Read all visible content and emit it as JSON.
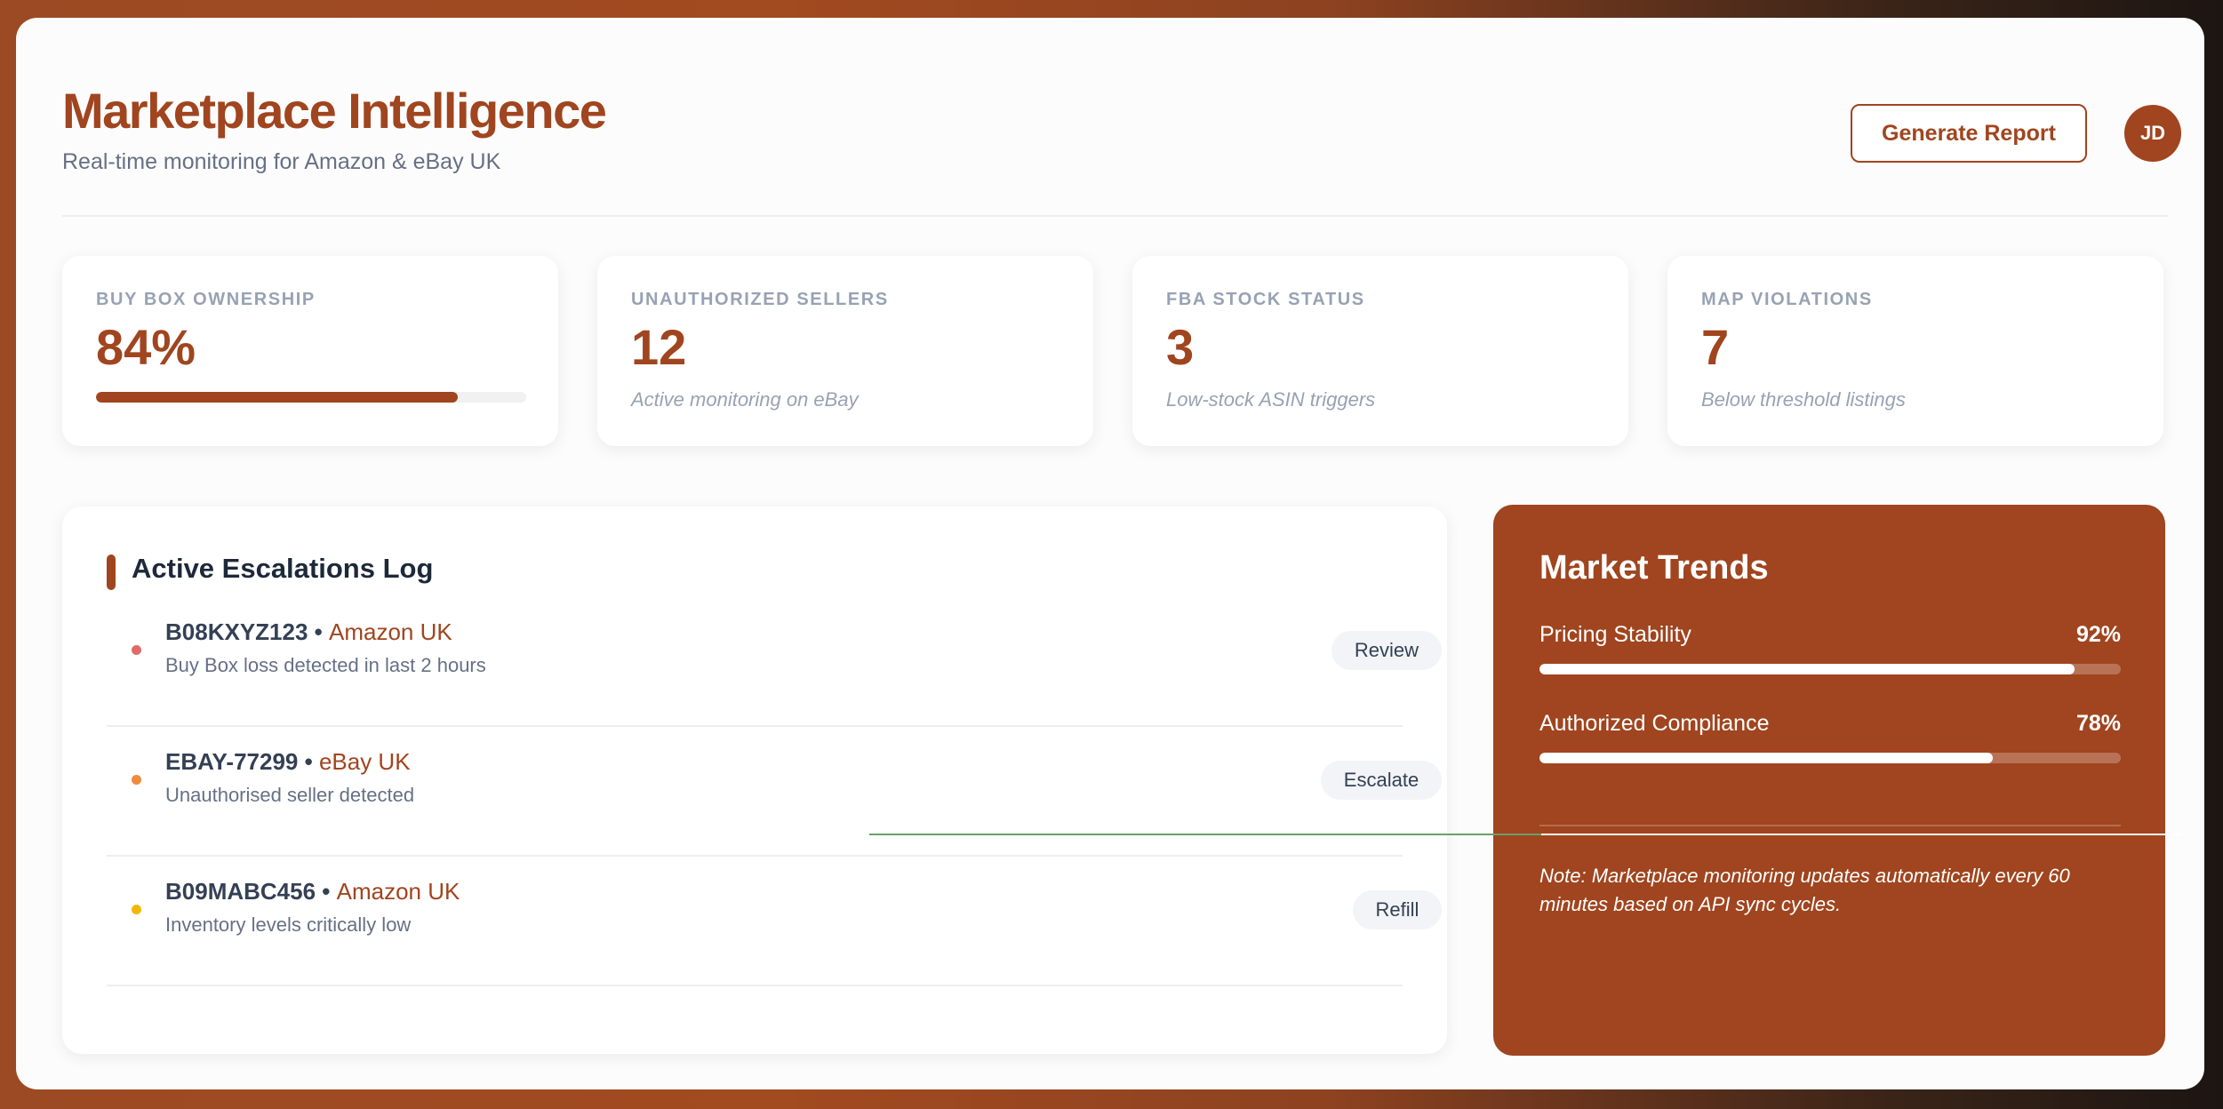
{
  "header": {
    "title": "Marketplace Intelligence",
    "subtitle": "Real-time monitoring for Amazon & eBay UK",
    "report_button": "Generate Report",
    "avatar_initials": "JD"
  },
  "stats": [
    {
      "label": "BUY BOX OWNERSHIP",
      "value": "84%",
      "progress_percent": 84
    },
    {
      "label": "UNAUTHORIZED SELLERS",
      "value": "12",
      "desc": "Active monitoring on eBay"
    },
    {
      "label": "FBA STOCK STATUS",
      "value": "3",
      "desc": "Low-stock ASIN triggers"
    },
    {
      "label": "MAP VIOLATIONS",
      "value": "7",
      "desc": "Below threshold listings"
    }
  ],
  "escalations": {
    "title": "Active Escalations Log",
    "rows": [
      {
        "id": "B08KXYZ123",
        "sep": " • ",
        "market": "Amazon UK",
        "desc": "Buy Box loss detected in last 2 hours",
        "action": "Review",
        "dot_color": "#e06a6a"
      },
      {
        "id": "EBAY-77299",
        "sep": " • ",
        "market": "eBay UK",
        "desc": "Unauthorised seller detected",
        "action": "Escalate",
        "dot_color": "#f08a3c"
      },
      {
        "id": "B09MABC456",
        "sep": " • ",
        "market": "Amazon UK",
        "desc": "Inventory levels critically low",
        "action": "Refill",
        "dot_color": "#f2b705"
      }
    ]
  },
  "trends": {
    "title": "Market Trends",
    "items": [
      {
        "label": "Pricing Stability",
        "value": "92%",
        "percent": 92
      },
      {
        "label": "Authorized Compliance",
        "value": "78%",
        "percent": 78
      }
    ],
    "note": "Note: Marketplace monitoring updates automatically every 60 minutes based on API sync cycles."
  },
  "colors": {
    "accent": "#a0451f"
  }
}
